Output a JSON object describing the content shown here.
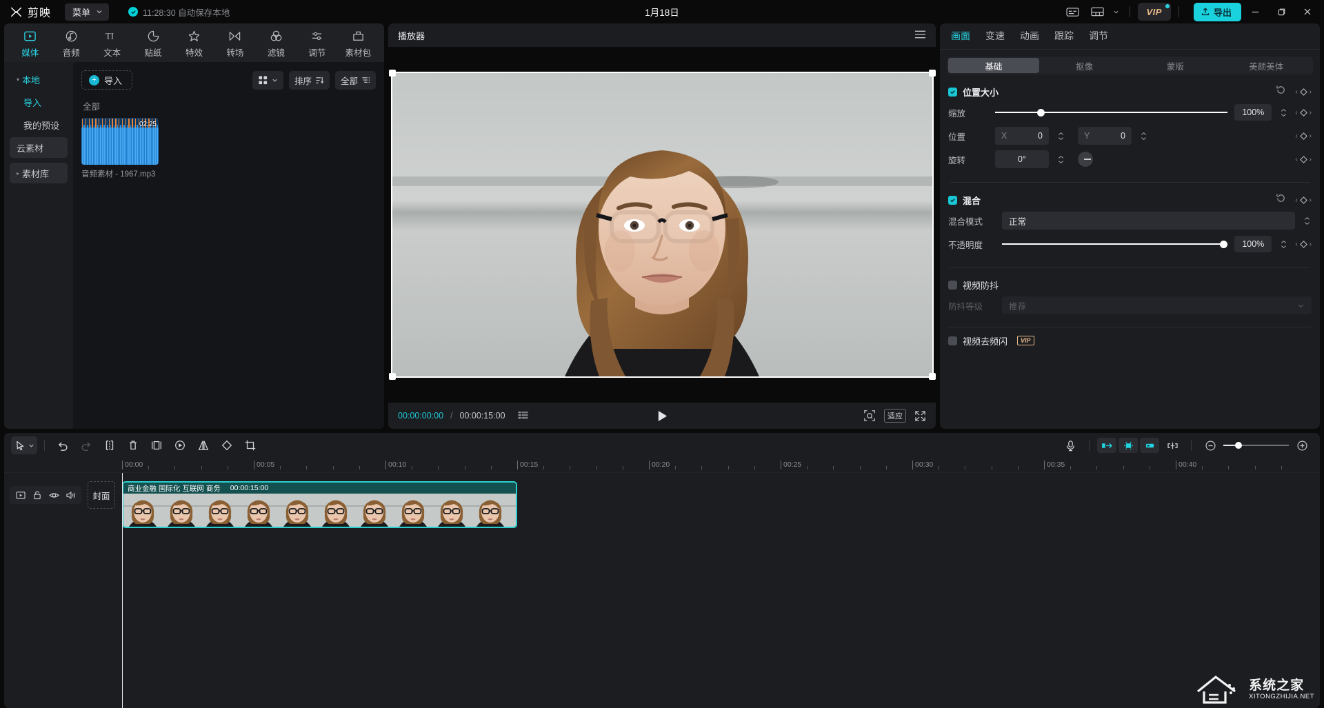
{
  "titlebar": {
    "app_name": "剪映",
    "menu_label": "菜单",
    "autosave_text": "11:28:30 自动保存本地",
    "project_title": "1月18日",
    "caption_icon": "caption-icon",
    "layout_icon": "layout-icon",
    "vip_label": "VIP",
    "export_label": "导出",
    "minimize_icon": "minimize-icon",
    "maximize_icon": "maximize-icon",
    "close_icon": "close-icon",
    "accent": "#19d2dd"
  },
  "left_panel": {
    "tabs": [
      {
        "label": "媒体",
        "icon": "media-icon",
        "active": true
      },
      {
        "label": "音频",
        "icon": "audio-icon",
        "active": false
      },
      {
        "label": "文本",
        "icon": "text-icon",
        "active": false
      },
      {
        "label": "贴纸",
        "icon": "sticker-icon",
        "active": false
      },
      {
        "label": "特效",
        "icon": "effects-icon",
        "active": false
      },
      {
        "label": "转场",
        "icon": "transition-icon",
        "active": false
      },
      {
        "label": "滤镜",
        "icon": "filter-icon",
        "active": false
      },
      {
        "label": "调节",
        "icon": "adjust-icon",
        "active": false
      },
      {
        "label": "素材包",
        "icon": "material-pack-icon",
        "active": false
      }
    ],
    "nav": [
      {
        "label": "本地",
        "root": true,
        "active": false,
        "boxed": false
      },
      {
        "label": "导入",
        "root": false,
        "active": true,
        "boxed": false
      },
      {
        "label": "我的预设",
        "root": false,
        "active": false,
        "boxed": false
      },
      {
        "label": "云素材",
        "root": false,
        "active": false,
        "boxed": true
      },
      {
        "label": "素材库",
        "root": true,
        "active": false,
        "boxed": true
      }
    ],
    "toolbar": {
      "import_label": "导入",
      "grid_icon": "grid-view-icon",
      "sort_label": "排序",
      "filter_label": "全部"
    },
    "section_label": "全部",
    "media_items": [
      {
        "name": "音频素材 - 1967.mp3",
        "duration": "02:25",
        "type": "audio"
      }
    ]
  },
  "player": {
    "title": "播放器",
    "menu_icon": "hamburger-icon",
    "current_time": "00:00:00:00",
    "separator": "/",
    "total_time": "00:00:15:00",
    "grid_icon": "frames-icon",
    "play_icon": "play-icon",
    "focus_icon": "focus-icon",
    "fit_label": "适应",
    "fullscreen_icon": "fullscreen-icon"
  },
  "right_panel": {
    "tabs": [
      {
        "label": "画面",
        "active": true
      },
      {
        "label": "变速",
        "active": false
      },
      {
        "label": "动画",
        "active": false
      },
      {
        "label": "跟踪",
        "active": false
      },
      {
        "label": "调节",
        "active": false
      }
    ],
    "subtabs": [
      {
        "label": "基础",
        "active": true
      },
      {
        "label": "抠像",
        "active": false
      },
      {
        "label": "蒙版",
        "active": false
      },
      {
        "label": "美颜美体",
        "active": false
      }
    ],
    "position_size": {
      "title": "位置大小",
      "checked": true,
      "reset_icon": "reset-icon",
      "scale_label": "缩放",
      "scale_value": "100%",
      "position_label": "位置",
      "pos_x_axis": "X",
      "pos_x_value": "0",
      "pos_y_axis": "Y",
      "pos_y_value": "0",
      "rotate_label": "旋转",
      "rotate_value": "0°"
    },
    "blend": {
      "title": "混合",
      "checked": true,
      "mode_label": "混合模式",
      "mode_value": "正常",
      "opacity_label": "不透明度",
      "opacity_value": "100%"
    },
    "stabilize": {
      "title": "视频防抖",
      "checked": false,
      "level_label": "防抖等级",
      "level_value": "推荐"
    },
    "deflicker": {
      "title": "视频去频闪",
      "checked": false,
      "vip_label": "VIP"
    }
  },
  "timeline": {
    "toolbar": {
      "select_icon": "cursor-select-icon",
      "undo_icon": "undo-icon",
      "redo_icon": "redo-icon",
      "split_icon": "split-icon",
      "delete_icon": "delete-icon",
      "separate_icon": "separate-audio-icon",
      "freeze_icon": "freeze-frame-icon",
      "mirror_icon": "mirror-icon",
      "rotate_icon": "rotate-icon",
      "crop_icon": "crop-icon",
      "mic_icon": "record-voiceover-icon",
      "snap_start_icon": "snap-left-icon",
      "snap_auto_icon": "auto-snap-icon",
      "snap_end_icon": "snap-right-icon",
      "link_icon": "link-clip-icon",
      "zoom_out_icon": "zoom-out-icon",
      "zoom_in_icon": "zoom-in-icon"
    },
    "ruler_labels": [
      "00:00",
      "00:05",
      "00:10",
      "00:15",
      "00:20",
      "00:25",
      "00:30",
      "00:35",
      "00:40"
    ],
    "track_header": {
      "track_icon": "video-track-icon",
      "lock_icon": "unlock-icon",
      "eye_icon": "visibility-icon",
      "mute_icon": "volume-icon",
      "cover_label": "封面"
    },
    "clip": {
      "label": "商业金融 国际化 互联网 商务",
      "duration": "00:00:15:00"
    }
  },
  "watermark": {
    "cn": "系统之家",
    "en": "XITONGZHIJIA.NET"
  }
}
